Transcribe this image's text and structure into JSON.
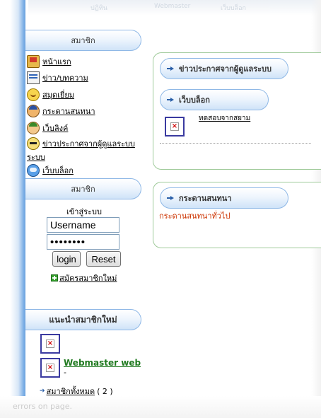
{
  "top": {
    "ghost_text": [
      "ปฏิทิน",
      "Webmaster",
      "เว็บบล็อก"
    ]
  },
  "sidebar": {
    "member_header": "สมาชิก",
    "items": [
      {
        "label": "หน้าแรก",
        "icon": "home-icon"
      },
      {
        "label": "ข่าว/บทความ",
        "icon": "news-icon"
      },
      {
        "label": "สมุดเยี่ยม",
        "icon": "guestbook-icon"
      },
      {
        "label": "กระดานสนทนา",
        "icon": "webboard-icon"
      },
      {
        "label": "เว็บลิงค์",
        "icon": "weblink-icon"
      },
      {
        "label": "ข่าวประกาศจากผู้ดูแลระบบ",
        "label_cont": "ระบบ",
        "icon": "admin-news-icon"
      },
      {
        "label": "เว็บบล็อก",
        "icon": "blog-icon"
      }
    ]
  },
  "login": {
    "header": "สมาชิก",
    "title": "เข้าสู่ระบบ",
    "username_value": "Username",
    "password_value": "••••••••",
    "login_label": "login",
    "reset_label": "Reset",
    "register_label": "สมัครสมาชิกใหม่"
  },
  "new_members": {
    "header": "แนะนำสมาชิกใหม่",
    "webmaster_name": "Webmaster web",
    "webmaster_sub": "-",
    "all_label": "สมาชิกทั้งหมด",
    "all_count": "( 2 )"
  },
  "main": {
    "admin_news_header": "ข่าวประกาศจากผู้ดูแลระบบ",
    "blog_header": "เว็บบล็อก",
    "blog_entry": "ทดสอบจากสยาม",
    "webboard_header": "กระดานสนทนา",
    "webboard_link": "กระดานสนทนาทั่วไป"
  },
  "status": {
    "text": "errors on page."
  },
  "colors": {
    "pill_border": "#8fb8e6",
    "panel_border": "#9fca9a",
    "link_red": "#cc3300",
    "member_green": "#207a20"
  }
}
